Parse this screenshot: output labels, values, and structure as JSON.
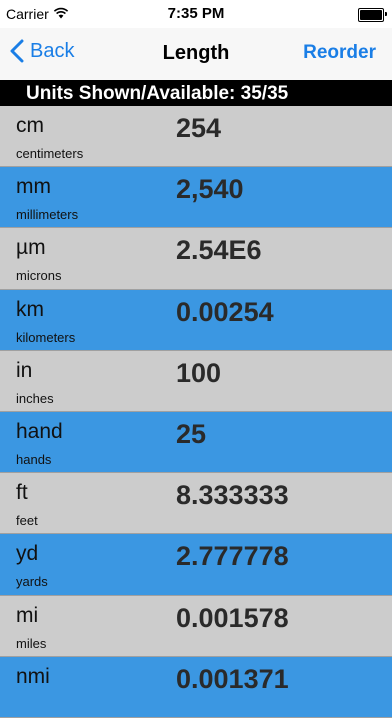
{
  "status_bar": {
    "carrier": "Carrier",
    "time": "7:35 PM",
    "wifi_icon": "wifi-icon",
    "battery_icon": "battery-icon"
  },
  "nav": {
    "back_label": "Back",
    "title": "Length",
    "reorder_label": "Reorder",
    "accent_color": "#1a7ee6"
  },
  "summary": {
    "text": "Units Shown/Available: 35/35"
  },
  "row_colors": {
    "gray": "#cccccc",
    "blue": "#3b97e2"
  },
  "units": [
    {
      "abbr": "cm",
      "name": "centimeters",
      "value": "254",
      "style": "gray"
    },
    {
      "abbr": "mm",
      "name": "millimeters",
      "value": "2,540",
      "style": "blue"
    },
    {
      "abbr": "µm",
      "name": "microns",
      "value": "2.54E6",
      "style": "gray"
    },
    {
      "abbr": "km",
      "name": "kilometers",
      "value": "0.00254",
      "style": "blue"
    },
    {
      "abbr": "in",
      "name": "inches",
      "value": "100",
      "style": "gray"
    },
    {
      "abbr": "hand",
      "name": "hands",
      "value": "25",
      "style": "blue"
    },
    {
      "abbr": "ft",
      "name": "feet",
      "value": "8.333333",
      "style": "gray"
    },
    {
      "abbr": "yd",
      "name": "yards",
      "value": "2.777778",
      "style": "blue"
    },
    {
      "abbr": "mi",
      "name": "miles",
      "value": "0.001578",
      "style": "gray"
    },
    {
      "abbr": "nmi",
      "name": "",
      "value": "0.001371",
      "style": "blue"
    }
  ]
}
